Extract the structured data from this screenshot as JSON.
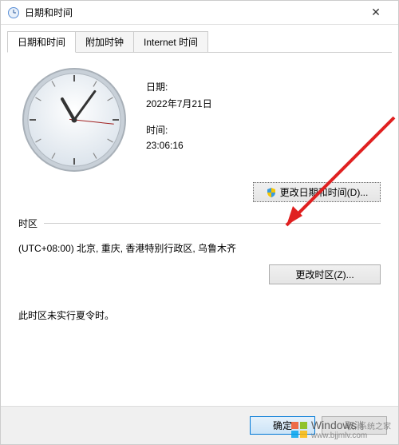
{
  "window": {
    "title": "日期和时间",
    "close": "✕"
  },
  "tabs": {
    "datetime": "日期和时间",
    "additional": "附加时钟",
    "internet": "Internet 时间"
  },
  "datetime": {
    "date_label": "日期:",
    "date_value": "2022年7月21日",
    "time_label": "时间:",
    "time_value": "23:06:16",
    "change_button": "更改日期和时间(D)..."
  },
  "timezone": {
    "section_label": "时区",
    "value": "(UTC+08:00) 北京, 重庆, 香港特别行政区, 乌鲁木齐",
    "change_button": "更改时区(Z)...",
    "dst_info": "此时区未实行夏令时。"
  },
  "buttons": {
    "ok": "确定",
    "cancel": "取消"
  },
  "watermark": {
    "brand": "Windows",
    "sub": "系统之家",
    "url": "www.bjjmlv.com"
  },
  "clock": {
    "hour_angle": 330,
    "minute_angle": 36,
    "second_angle": 96
  }
}
